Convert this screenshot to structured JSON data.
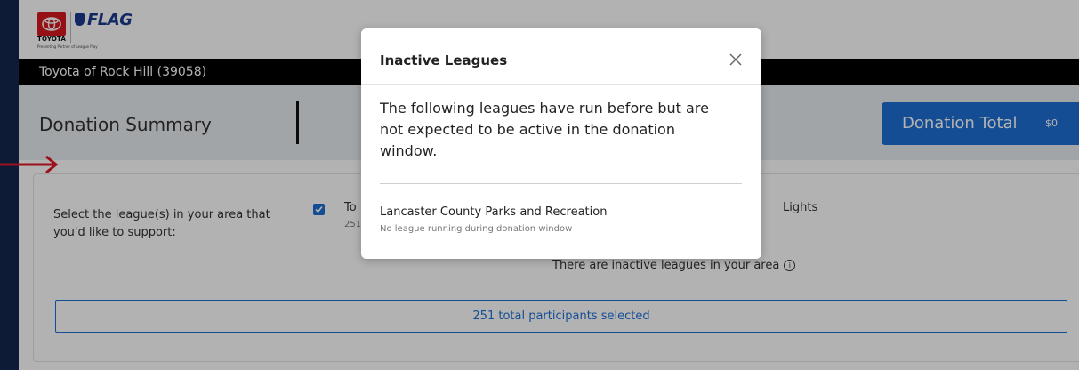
{
  "header": {
    "brand": "TOYOTA",
    "brand_tagline": "Presenting Partner of League Play",
    "flag_logo": "FLAG"
  },
  "dealer": {
    "name": "Toyota of Rock Hill (39058)"
  },
  "summary": {
    "title": "Donation Summary",
    "donation_label": "Donation Total",
    "donation_amount": "$0"
  },
  "content": {
    "select_label": "Select the league(s) in your area that you'd like to support:",
    "league_name_visible": "To",
    "league_count_visible": "251",
    "league2_name_visible": "Lights",
    "inactive_note": "There are inactive leagues in your area",
    "participants_selected": "251 total participants selected"
  },
  "modal": {
    "title": "Inactive Leagues",
    "body": "The following leagues have run before but are not expected to be active in the donation window.",
    "inactive_leagues": [
      {
        "name": "Lancaster County Parks and Recreation",
        "status": "No league running during donation window"
      }
    ]
  },
  "colors": {
    "accent": "#1f6fd6",
    "side_bar": "#13284f",
    "dealer_bar": "#000000",
    "summary_bg": "#e9ecef",
    "arrow": "#e0182b",
    "toyota_red": "#d71920"
  }
}
